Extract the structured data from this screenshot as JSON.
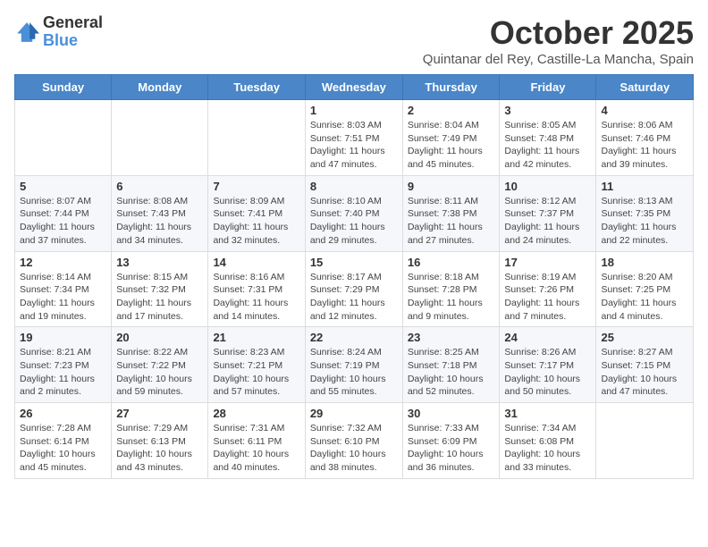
{
  "header": {
    "logo_general": "General",
    "logo_blue": "Blue",
    "month_title": "October 2025",
    "subtitle": "Quintanar del Rey, Castille-La Mancha, Spain"
  },
  "weekdays": [
    "Sunday",
    "Monday",
    "Tuesday",
    "Wednesday",
    "Thursday",
    "Friday",
    "Saturday"
  ],
  "weeks": [
    [
      {
        "day": "",
        "sunrise": "",
        "sunset": "",
        "daylight": ""
      },
      {
        "day": "",
        "sunrise": "",
        "sunset": "",
        "daylight": ""
      },
      {
        "day": "",
        "sunrise": "",
        "sunset": "",
        "daylight": ""
      },
      {
        "day": "1",
        "sunrise": "Sunrise: 8:03 AM",
        "sunset": "Sunset: 7:51 PM",
        "daylight": "Daylight: 11 hours and 47 minutes."
      },
      {
        "day": "2",
        "sunrise": "Sunrise: 8:04 AM",
        "sunset": "Sunset: 7:49 PM",
        "daylight": "Daylight: 11 hours and 45 minutes."
      },
      {
        "day": "3",
        "sunrise": "Sunrise: 8:05 AM",
        "sunset": "Sunset: 7:48 PM",
        "daylight": "Daylight: 11 hours and 42 minutes."
      },
      {
        "day": "4",
        "sunrise": "Sunrise: 8:06 AM",
        "sunset": "Sunset: 7:46 PM",
        "daylight": "Daylight: 11 hours and 39 minutes."
      }
    ],
    [
      {
        "day": "5",
        "sunrise": "Sunrise: 8:07 AM",
        "sunset": "Sunset: 7:44 PM",
        "daylight": "Daylight: 11 hours and 37 minutes."
      },
      {
        "day": "6",
        "sunrise": "Sunrise: 8:08 AM",
        "sunset": "Sunset: 7:43 PM",
        "daylight": "Daylight: 11 hours and 34 minutes."
      },
      {
        "day": "7",
        "sunrise": "Sunrise: 8:09 AM",
        "sunset": "Sunset: 7:41 PM",
        "daylight": "Daylight: 11 hours and 32 minutes."
      },
      {
        "day": "8",
        "sunrise": "Sunrise: 8:10 AM",
        "sunset": "Sunset: 7:40 PM",
        "daylight": "Daylight: 11 hours and 29 minutes."
      },
      {
        "day": "9",
        "sunrise": "Sunrise: 8:11 AM",
        "sunset": "Sunset: 7:38 PM",
        "daylight": "Daylight: 11 hours and 27 minutes."
      },
      {
        "day": "10",
        "sunrise": "Sunrise: 8:12 AM",
        "sunset": "Sunset: 7:37 PM",
        "daylight": "Daylight: 11 hours and 24 minutes."
      },
      {
        "day": "11",
        "sunrise": "Sunrise: 8:13 AM",
        "sunset": "Sunset: 7:35 PM",
        "daylight": "Daylight: 11 hours and 22 minutes."
      }
    ],
    [
      {
        "day": "12",
        "sunrise": "Sunrise: 8:14 AM",
        "sunset": "Sunset: 7:34 PM",
        "daylight": "Daylight: 11 hours and 19 minutes."
      },
      {
        "day": "13",
        "sunrise": "Sunrise: 8:15 AM",
        "sunset": "Sunset: 7:32 PM",
        "daylight": "Daylight: 11 hours and 17 minutes."
      },
      {
        "day": "14",
        "sunrise": "Sunrise: 8:16 AM",
        "sunset": "Sunset: 7:31 PM",
        "daylight": "Daylight: 11 hours and 14 minutes."
      },
      {
        "day": "15",
        "sunrise": "Sunrise: 8:17 AM",
        "sunset": "Sunset: 7:29 PM",
        "daylight": "Daylight: 11 hours and 12 minutes."
      },
      {
        "day": "16",
        "sunrise": "Sunrise: 8:18 AM",
        "sunset": "Sunset: 7:28 PM",
        "daylight": "Daylight: 11 hours and 9 minutes."
      },
      {
        "day": "17",
        "sunrise": "Sunrise: 8:19 AM",
        "sunset": "Sunset: 7:26 PM",
        "daylight": "Daylight: 11 hours and 7 minutes."
      },
      {
        "day": "18",
        "sunrise": "Sunrise: 8:20 AM",
        "sunset": "Sunset: 7:25 PM",
        "daylight": "Daylight: 11 hours and 4 minutes."
      }
    ],
    [
      {
        "day": "19",
        "sunrise": "Sunrise: 8:21 AM",
        "sunset": "Sunset: 7:23 PM",
        "daylight": "Daylight: 11 hours and 2 minutes."
      },
      {
        "day": "20",
        "sunrise": "Sunrise: 8:22 AM",
        "sunset": "Sunset: 7:22 PM",
        "daylight": "Daylight: 10 hours and 59 minutes."
      },
      {
        "day": "21",
        "sunrise": "Sunrise: 8:23 AM",
        "sunset": "Sunset: 7:21 PM",
        "daylight": "Daylight: 10 hours and 57 minutes."
      },
      {
        "day": "22",
        "sunrise": "Sunrise: 8:24 AM",
        "sunset": "Sunset: 7:19 PM",
        "daylight": "Daylight: 10 hours and 55 minutes."
      },
      {
        "day": "23",
        "sunrise": "Sunrise: 8:25 AM",
        "sunset": "Sunset: 7:18 PM",
        "daylight": "Daylight: 10 hours and 52 minutes."
      },
      {
        "day": "24",
        "sunrise": "Sunrise: 8:26 AM",
        "sunset": "Sunset: 7:17 PM",
        "daylight": "Daylight: 10 hours and 50 minutes."
      },
      {
        "day": "25",
        "sunrise": "Sunrise: 8:27 AM",
        "sunset": "Sunset: 7:15 PM",
        "daylight": "Daylight: 10 hours and 47 minutes."
      }
    ],
    [
      {
        "day": "26",
        "sunrise": "Sunrise: 7:28 AM",
        "sunset": "Sunset: 6:14 PM",
        "daylight": "Daylight: 10 hours and 45 minutes."
      },
      {
        "day": "27",
        "sunrise": "Sunrise: 7:29 AM",
        "sunset": "Sunset: 6:13 PM",
        "daylight": "Daylight: 10 hours and 43 minutes."
      },
      {
        "day": "28",
        "sunrise": "Sunrise: 7:31 AM",
        "sunset": "Sunset: 6:11 PM",
        "daylight": "Daylight: 10 hours and 40 minutes."
      },
      {
        "day": "29",
        "sunrise": "Sunrise: 7:32 AM",
        "sunset": "Sunset: 6:10 PM",
        "daylight": "Daylight: 10 hours and 38 minutes."
      },
      {
        "day": "30",
        "sunrise": "Sunrise: 7:33 AM",
        "sunset": "Sunset: 6:09 PM",
        "daylight": "Daylight: 10 hours and 36 minutes."
      },
      {
        "day": "31",
        "sunrise": "Sunrise: 7:34 AM",
        "sunset": "Sunset: 6:08 PM",
        "daylight": "Daylight: 10 hours and 33 minutes."
      },
      {
        "day": "",
        "sunrise": "",
        "sunset": "",
        "daylight": ""
      }
    ]
  ]
}
